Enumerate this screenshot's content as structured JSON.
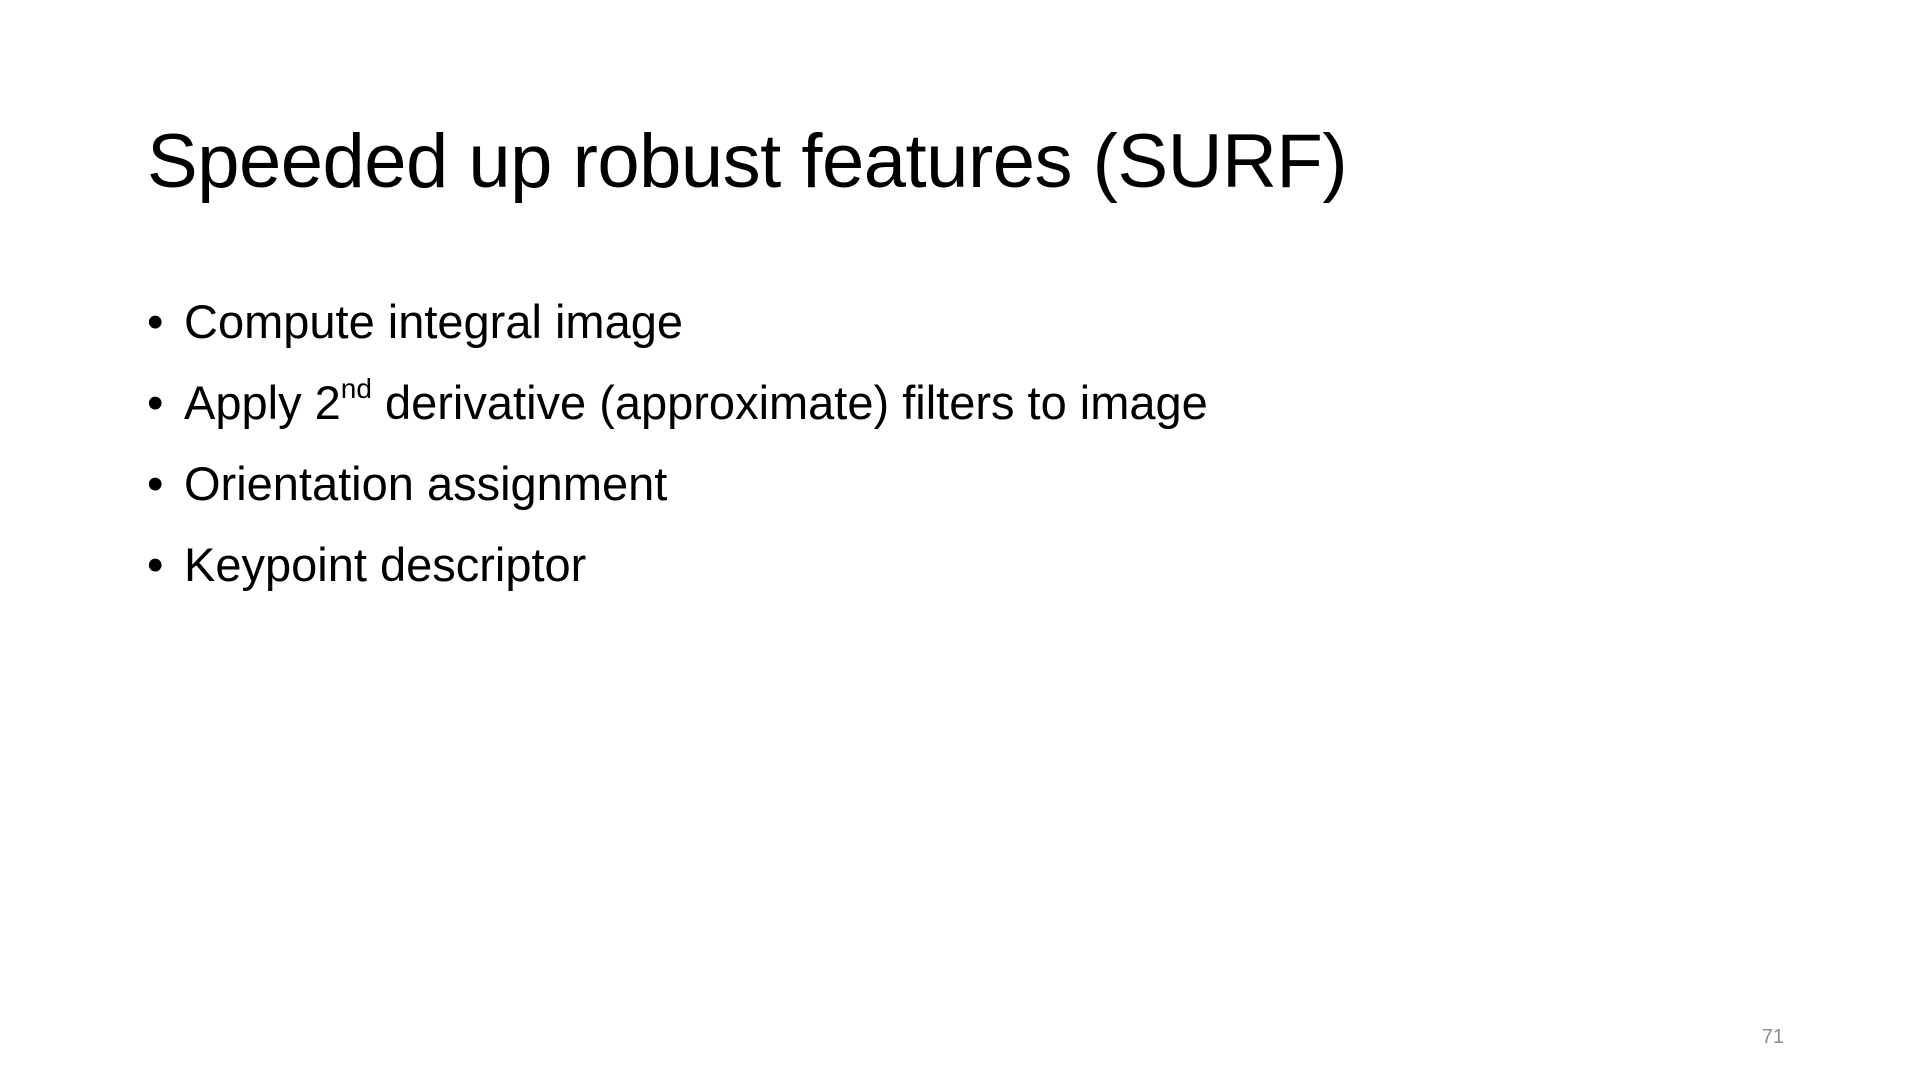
{
  "slide": {
    "title": "Speeded up robust features (SURF)",
    "bullet_glyph": "•",
    "bullets": [
      {
        "text": "Compute integral image"
      },
      {
        "pre": "Apply 2",
        "sup": "nd",
        "post": " derivative (approximate) filters to image"
      },
      {
        "text": "Orientation assignment"
      },
      {
        "text": "Keypoint descriptor"
      }
    ],
    "page_number": "71"
  },
  "colors": {
    "background": "#ffffff",
    "text": "#000000",
    "page_number": "#8c8c8c"
  }
}
